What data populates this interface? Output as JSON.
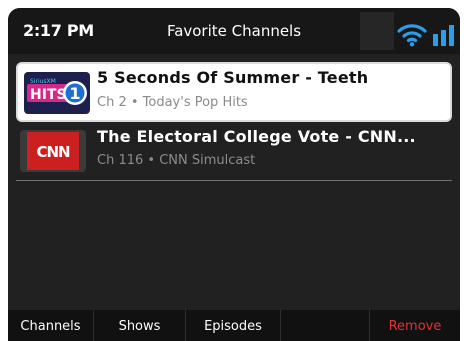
{
  "status": {
    "time": "2:17 PM",
    "title": "Favorite Channels"
  },
  "icons": {
    "wifi": "wifi-icon",
    "signal": "signal-strength-icon"
  },
  "channels": [
    {
      "title": "5 Seconds Of Summer - Teeth",
      "subtitle": "Ch 2 • Today's Pop Hits",
      "logo": "siriusxm-hits1-logo",
      "selected": true
    },
    {
      "title": "The Electoral College Vote - CNN...",
      "subtitle": "Ch 116 • CNN Simulcast",
      "logo": "cnn-logo",
      "selected": false
    }
  ],
  "logos": {
    "hits_sirius": "SiriusXM",
    "hits_word": "HITS",
    "hits_number": "1",
    "cnn_text": "CNN"
  },
  "softkeys": {
    "channels": "Channels",
    "shows": "Shows",
    "episodes": "Episodes",
    "empty": "",
    "remove": "Remove"
  },
  "colors": {
    "background": "#212121",
    "remove": "#e33232",
    "wifi": "#2a9ee8",
    "cnn_red": "#cc1f1f"
  }
}
